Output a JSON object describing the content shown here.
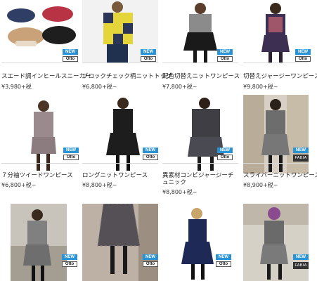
{
  "badges": {
    "new": "NEW",
    "otto": "Otto",
    "fabia": "FABIA"
  },
  "products": [
    {
      "name": "スエード調インヒールスニーカー",
      "price": "¥3,980+税"
    },
    {
      "name": "ブロックチェック柄ニットトップ",
      "price": "¥6,800+税~"
    },
    {
      "name": "配色切替えニットワンピース",
      "price": "¥7,800+税~"
    },
    {
      "name": "切替えジャージーワンピース",
      "price": "¥9,800+税~"
    },
    {
      "name": "７分袖ツイードワンピース",
      "price": "¥6,800+税~"
    },
    {
      "name": "ロングニットワンピース",
      "price": "¥8,800+税~"
    },
    {
      "name": "異素材コンビジャージーチュニック",
      "price": "¥8,800+税~"
    },
    {
      "name": "スライバーニットワンピース",
      "price": "¥8,900+税~"
    },
    {
      "name": "",
      "price": ""
    },
    {
      "name": "",
      "price": ""
    },
    {
      "name": "",
      "price": ""
    },
    {
      "name": "",
      "price": ""
    }
  ],
  "colors": {
    "new_badge": "#2a93d5",
    "fabia_badge": "#333333"
  }
}
